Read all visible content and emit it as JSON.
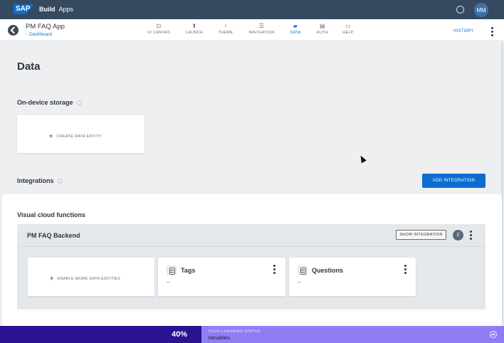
{
  "shell": {
    "logo": "SAP",
    "brand": "Build",
    "product": "Apps",
    "avatar_initials": "MM",
    "notification_icon": "chat-bubble-icon"
  },
  "appbar": {
    "app_name": "PM FAQ App",
    "breadcrumb": "Dashboard",
    "history": "HISTORY",
    "nav": [
      {
        "label": "UI CANVAS",
        "icon": "canvas-icon",
        "glyph": "⊡",
        "active": false
      },
      {
        "label": "LAUNCH",
        "icon": "launch-icon",
        "glyph": "⬆",
        "active": false
      },
      {
        "label": "THEME",
        "icon": "theme-brush-icon",
        "glyph": "⍿",
        "active": false
      },
      {
        "label": "NAVIGATION",
        "icon": "navigation-list-icon",
        "glyph": "☰",
        "active": false
      },
      {
        "label": "DATA",
        "icon": "folder-icon",
        "glyph": "▰",
        "active": true
      },
      {
        "label": "AUTH",
        "icon": "auth-document-icon",
        "glyph": "▤",
        "active": false
      },
      {
        "label": "HELP",
        "icon": "help-chat-icon",
        "glyph": "▭",
        "active": false
      }
    ]
  },
  "main": {
    "title": "Data",
    "on_device_storage": {
      "label": "On-device storage",
      "create_entity": "CREATE DATA ENTITY"
    },
    "integrations": {
      "label": "Integrations",
      "add_button": "ADD INTEGRATION"
    },
    "visual_cloud_functions": {
      "label": "Visual cloud functions",
      "backend": {
        "name": "PM FAQ Backend",
        "show_integration": "SHOW INTEGRATION",
        "count": "2",
        "enable_more": "ENABLE MORE DATA ENTITIES",
        "entities": [
          {
            "name": "Tags",
            "detail": "–"
          },
          {
            "name": "Questions",
            "detail": "–"
          }
        ]
      }
    }
  },
  "learning": {
    "percent": "40%",
    "progress_fraction": 0.4,
    "label": "YOUR LEARNING STATUS",
    "value": "Variables"
  },
  "colors": {
    "shell": "#354a5f",
    "accent": "#0a6ed1",
    "learning_dark": "#2a1290",
    "learning_light": "#8f7ef3"
  }
}
